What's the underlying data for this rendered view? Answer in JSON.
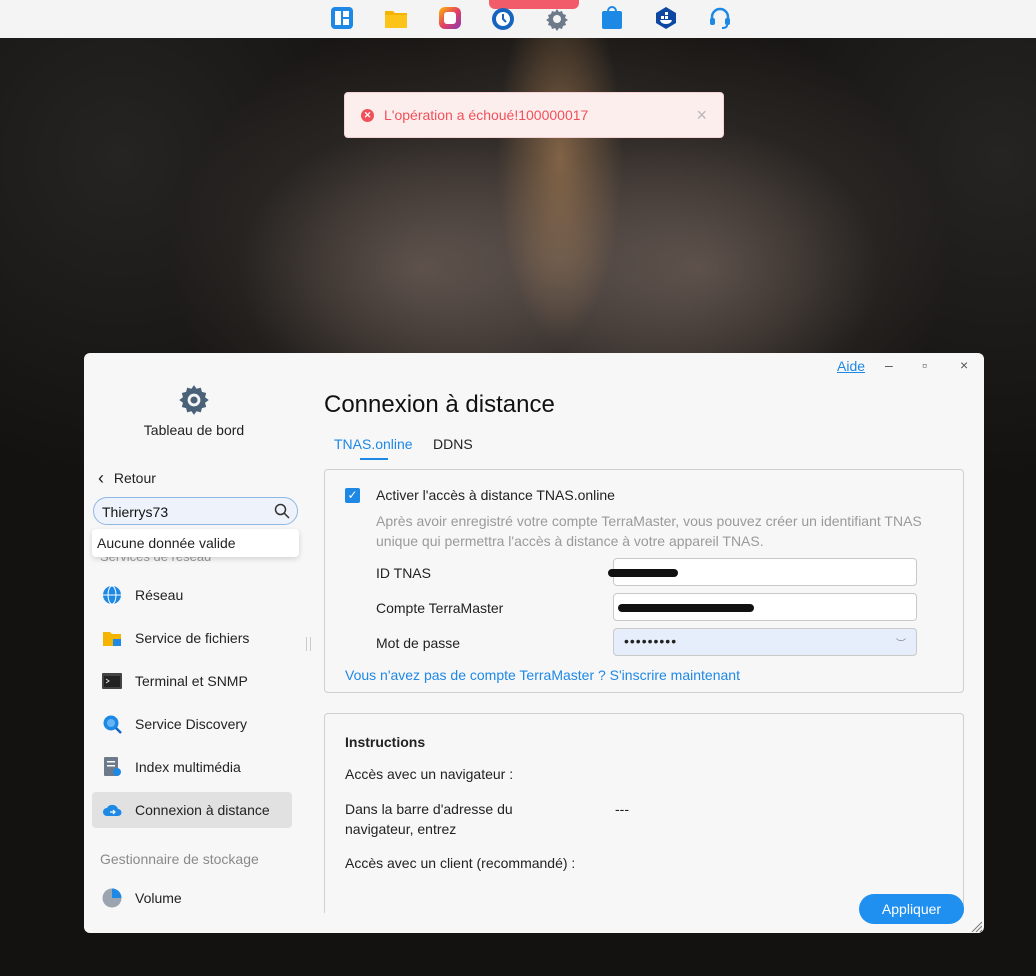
{
  "taskbar": {
    "icons": [
      {
        "name": "control-panel-icon",
        "color": "#1e88e5"
      },
      {
        "name": "file-manager-icon",
        "color": "#f5b400"
      },
      {
        "name": "app-center-icon",
        "color": "#e4405f"
      },
      {
        "name": "backup-icon",
        "color": "#1565c0"
      },
      {
        "name": "settings-icon",
        "color": "#6c7a89"
      },
      {
        "name": "shop-icon",
        "color": "#1e88e5"
      },
      {
        "name": "docker-icon",
        "color": "#0d47a1"
      },
      {
        "name": "support-icon",
        "color": "#1e88e5"
      }
    ]
  },
  "toast": {
    "message": "L'opération a échoué!100000017",
    "close": "×",
    "color": "#f0505a"
  },
  "window": {
    "help": "Aide",
    "minimize": "–",
    "maximize": "▫",
    "close": "×"
  },
  "sidebar": {
    "dashboard_label": "Tableau de bord",
    "back_label": "Retour",
    "search_value": "Thierrys73",
    "dropdown_text": "Aucune donnée valide",
    "section_network": "Services de réseau",
    "items": [
      {
        "label": "Réseau",
        "icon": "globe-icon"
      },
      {
        "label": "Service de fichiers",
        "icon": "folder-share-icon"
      },
      {
        "label": "Terminal et SNMP",
        "icon": "terminal-icon"
      },
      {
        "label": "Service Discovery",
        "icon": "discovery-icon"
      },
      {
        "label": "Index multimédia",
        "icon": "media-index-icon"
      },
      {
        "label": "Connexion à distance",
        "icon": "cloud-remote-icon"
      }
    ],
    "section_storage": "Gestionnaire de stockage",
    "storage_items": [
      {
        "label": "Volume",
        "icon": "volume-icon"
      }
    ]
  },
  "main": {
    "title": "Connexion à distance",
    "tabs": [
      {
        "label": "TNAS.online",
        "active": true
      },
      {
        "label": "DDNS",
        "active": false
      }
    ],
    "enable_label": "Activer l'accès à distance TNAS.online",
    "description": "Après avoir enregistré votre compte TerraMaster, vous pouvez créer un identifiant TNAS unique qui permettra l'accès à distance à votre appareil TNAS.",
    "fields": {
      "tnas_id_label": "ID TNAS",
      "account_label": "Compte TerraMaster",
      "password_label": "Mot de passe",
      "password_value": "•••••••••"
    },
    "register_link": "Vous n'avez pas de compte TerraMaster ? S'inscrire maintenant",
    "instructions": {
      "title": "Instructions",
      "browser_access": "Accès avec un navigateur :",
      "address_bar": "Dans la barre d'adresse du navigateur, entrez",
      "address_value": "---",
      "client_access": "Accès avec un client (recommandé) :"
    },
    "apply_button": "Appliquer"
  }
}
